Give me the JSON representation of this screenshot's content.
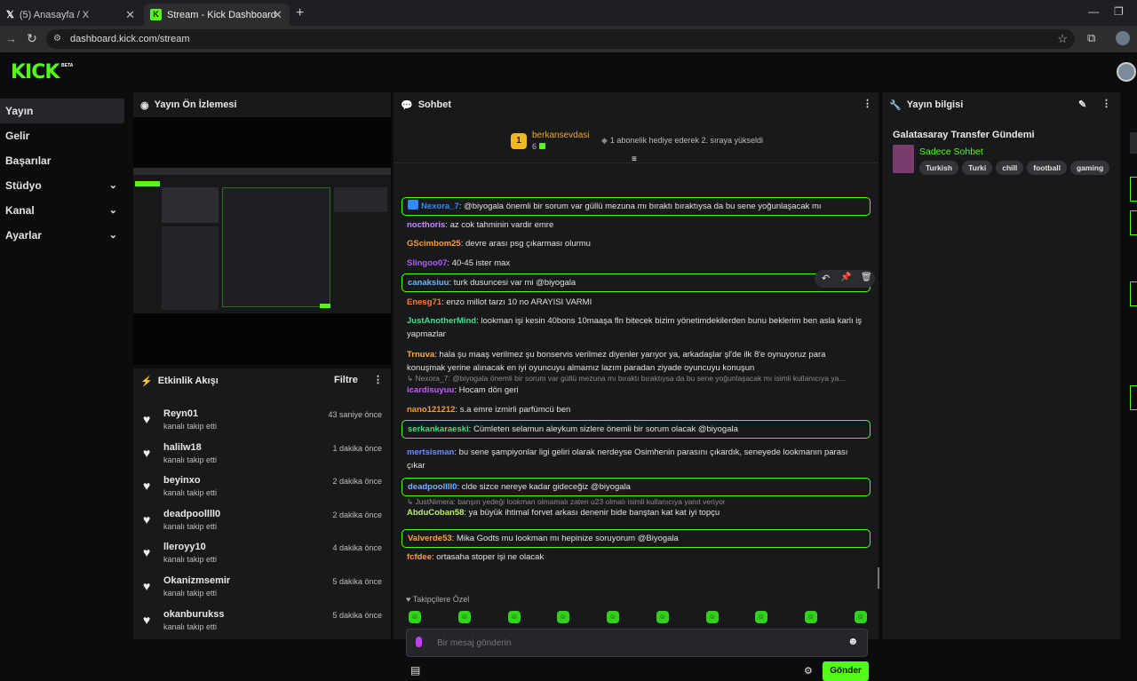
{
  "browser": {
    "tabs": [
      {
        "title": "(5) Anasayfa / X",
        "icon": "X"
      },
      {
        "title": "Stream - Kick Dashboard",
        "icon": "K"
      }
    ],
    "url": "dashboard.kick.com/stream"
  },
  "brand": {
    "logo": "KICK",
    "badge": "BETA",
    "accent": "#53fc18"
  },
  "sidebar": {
    "items": [
      {
        "label": "Yayın"
      },
      {
        "label": "Gelir"
      },
      {
        "label": "Başarılar"
      },
      {
        "label": "Stüdyo"
      },
      {
        "label": "Kanal"
      },
      {
        "label": "Ayarlar"
      }
    ]
  },
  "preview": {
    "title": "Yayın Ön İzlemesi"
  },
  "activity": {
    "title": "Etkinlik Akışı",
    "filter_label": "Filtre",
    "events": [
      {
        "name": "Reyn01",
        "action": "kanalı takip etti",
        "time": "43 saniye önce"
      },
      {
        "name": "halilw18",
        "action": "kanalı takip etti",
        "time": "1 dakika önce"
      },
      {
        "name": "beyinxo",
        "action": "kanalı takip etti",
        "time": "2 dakika önce"
      },
      {
        "name": "deadpoollll0",
        "action": "kanalı takip etti",
        "time": "2 dakika önce"
      },
      {
        "name": "lleroyy10",
        "action": "kanalı takip etti",
        "time": "4 dakika önce"
      },
      {
        "name": "Okanizmsemir",
        "action": "kanalı takip etti",
        "time": "5 dakika önce"
      },
      {
        "name": "okanburukss",
        "action": "kanalı takip etti",
        "time": "5 dakika önce"
      }
    ]
  },
  "chat": {
    "title": "Sohbet",
    "pinned": {
      "rank": "1",
      "user": "berkansevdasi",
      "count": "6",
      "text": "1 abonelik hediye ederek 2. sıraya yükseldi"
    },
    "messages": [
      {
        "user": "Nexora_7",
        "color": "#2d8cff",
        "text": "@biyogala önemli bir sorum var güllü mezuna mı bıraktı bıraktıysa da bu sene yoğunlaşacak mı",
        "hl": true
      },
      {
        "user": "nocthoris",
        "color": "#c48cff",
        "text": "az cok tahminin vardir emre",
        "hl": false
      },
      {
        "user": "GScimbom25",
        "color": "#ff9a2e",
        "text": "devre arası psg çıkarması olurmu",
        "hl": false
      },
      {
        "user": "Slingoo07",
        "color": "#b05cff",
        "text": "40-45 ister max",
        "hl": false
      },
      {
        "user": "canaksiuu",
        "color": "#6fb4ff",
        "text": "turk dusuncesi var mi @biyogala",
        "hl": true
      },
      {
        "user": "Enesg71",
        "color": "#ff7b3b",
        "text": "enzo millot tarzı 10 no ARAYISI VARMI",
        "hl": false
      },
      {
        "user": "JustAnotherMind",
        "color": "#3ee08c",
        "text": "lookman işi kesin 40bons 10maaşa fln bitecek bizim yönetimdekilerden bunu beklerim ben asla karlı iş yapmazlar",
        "hl": false
      },
      {
        "user": "Trnuva",
        "color": "#ffb02e",
        "text": "hala şu maaş verilmez şu bonservis verilmez diyenler yarıyor ya, arkadaşlar şl'de ilk 8'e oynuyoruz para konuşmak yerine alınacak en iyi oyuncuyu almamız lazım paradan ziyade oyuncuyu konuşun",
        "hl": false
      },
      {
        "user": "icardisuyuu",
        "color": "#c85cff",
        "text": "Hocam dön geri",
        "hl": false,
        "reply": "Nexora_7: @biyogala önemli bir sorum var güllü mezuna mı bıraktı bıraktıysa da bu sene yoğunlaşacak mı isimli kullanıcıya ya..."
      },
      {
        "user": "nano121212",
        "color": "#ff9a2e",
        "text": "s.a emre izmirli parfümcü ben",
        "hl": false
      },
      {
        "user": "serkankaraeski",
        "color": "#3ee07a",
        "text": "Cümleten selamun aleykum sizlere önemli bir sorum olacak @biyogala",
        "hl": true
      },
      {
        "user": "mertsisman",
        "color": "#6c8cff",
        "text": "bu sene şampiyonlar ligi geliri olarak nerdeyse Osimhenin parasını çıkardık, seneyede lookmanın parası çıkar",
        "hl": false
      },
      {
        "user": "deadpoollll0",
        "color": "#6fb4ff",
        "text": "clde sizce nereye kadar gideceğiz @biyogala",
        "hl": true
      },
      {
        "user": "AbduCoban58",
        "color": "#b8f06a",
        "text": "ya büyük ihtimal forvet arkası denenir bide banştan kat kat iyi topçu",
        "hl": false,
        "reply": "JustNimera: banşın yedeği lookman olmamalı zaten u23 olmalı isimli kullanıcıya yanıt veriyor"
      },
      {
        "user": "Valverde53",
        "color": "#ffa43b",
        "text": "Mika Godts mu lookman mı hepinize soruyorum @Biyogala",
        "hl": true
      },
      {
        "user": "fcfdee",
        "color": "#ff9a2e",
        "text": "ortasaha stoper işi ne olacak",
        "hl": false
      }
    ],
    "followers_only": "Takipçilere Özel",
    "input_placeholder": "Bir mesaj gönderin",
    "send_label": "Gönder"
  },
  "info": {
    "title": "Yayın bilgisi",
    "stream_title": "Galatasaray Transfer Gündemi",
    "category": "Sadece Sohbet",
    "tags": [
      "Turkish",
      "Turki",
      "chill",
      "football",
      "gaming"
    ]
  }
}
